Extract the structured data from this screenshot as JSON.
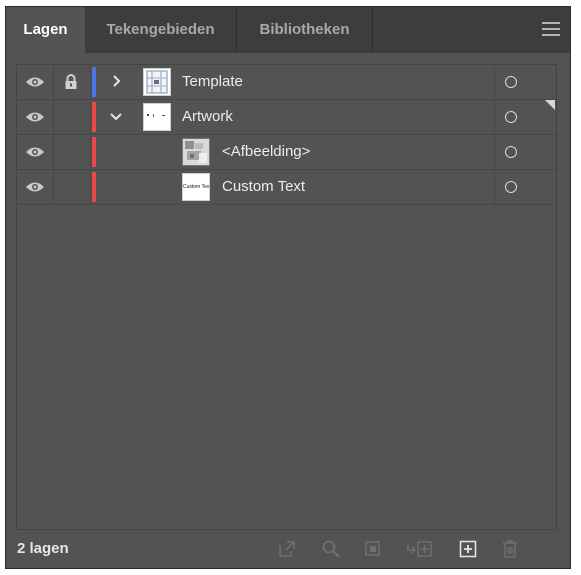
{
  "tabs": [
    {
      "label": "Lagen",
      "active": true
    },
    {
      "label": "Tekengebieden",
      "active": false
    },
    {
      "label": "Bibliotheken",
      "active": false
    }
  ],
  "menu_icon": "hamburger-menu-icon",
  "layers": [
    {
      "name": "Template",
      "level": 0,
      "expanded": false,
      "visible": true,
      "locked": true,
      "color": "#4a74e8",
      "thumb": "template"
    },
    {
      "name": "Artwork",
      "level": 0,
      "expanded": true,
      "visible": true,
      "locked": false,
      "color": "#e84a4a",
      "thumb": "artwork",
      "selected_marker": true
    },
    {
      "name": "<Afbeelding>",
      "level": 1,
      "visible": true,
      "locked": false,
      "color": "#e84a4a",
      "thumb": "image"
    },
    {
      "name": "Custom Text",
      "level": 1,
      "visible": true,
      "locked": false,
      "color": "#e84a4a",
      "thumb": "text",
      "thumb_text": "Custom Text"
    }
  ],
  "footer": {
    "count_label": "2 lagen",
    "icons": [
      "export-icon",
      "search-icon",
      "clipping-mask-icon",
      "move-to-layer-icon",
      "new-layer-icon",
      "delete-icon"
    ]
  },
  "colors": {
    "panel_bg": "#535353",
    "tabbar_bg": "#3d3d3d",
    "template_layer": "#4a74e8",
    "artwork_layer": "#e84a4a"
  }
}
